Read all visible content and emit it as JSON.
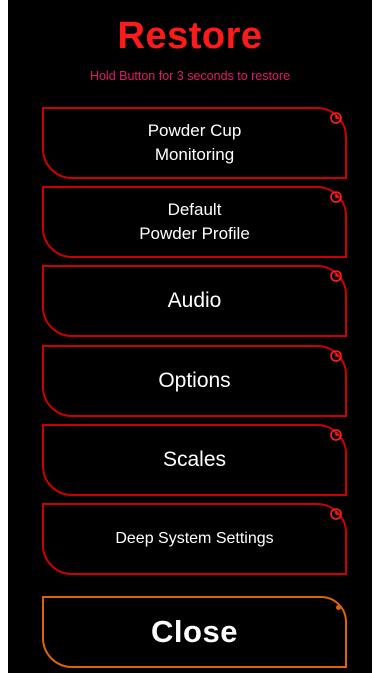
{
  "title": "Restore",
  "subtitle": "Hold Button for 3 seconds to restore",
  "buttons": [
    {
      "lines": [
        "Powder Cup",
        "Monitoring"
      ],
      "icon": "clock-icon"
    },
    {
      "lines": [
        "Default",
        "Powder Profile"
      ],
      "icon": "clock-icon"
    },
    {
      "lines": [
        "Audio"
      ],
      "icon": "clock-icon"
    },
    {
      "lines": [
        "Options"
      ],
      "icon": "clock-icon"
    },
    {
      "lines": [
        "Scales"
      ],
      "icon": "clock-icon"
    },
    {
      "lines": [
        "Deep System Settings"
      ],
      "icon": "clock-icon"
    }
  ],
  "close_label": "Close",
  "colors": {
    "background": "#000000",
    "title": "#ff1a1a",
    "subtitle": "#e2186e",
    "restore_border": "#cc0000",
    "close_border": "#e06400",
    "text": "#ffffff"
  }
}
